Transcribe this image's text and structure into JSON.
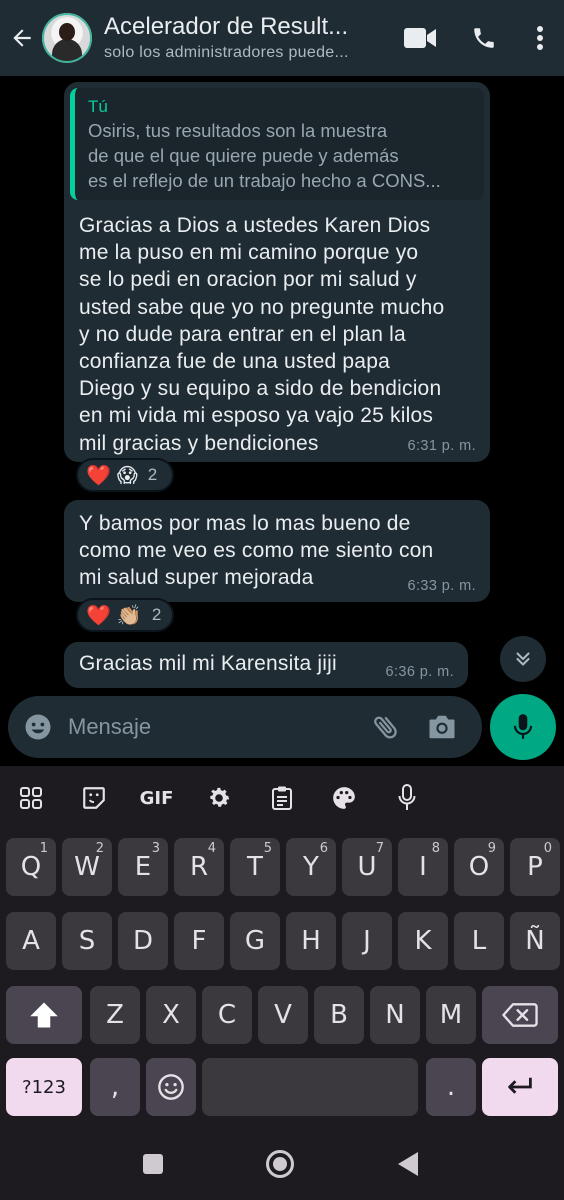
{
  "header": {
    "title": "Acelerador de Result...",
    "subtitle": "solo los administradores puede...",
    "icons": [
      "back-arrow-icon",
      "video-call-icon",
      "phone-icon",
      "more-vert-icon"
    ]
  },
  "messages": [
    {
      "quote": {
        "author": "Tú",
        "text": "Osiris, tus resultados son la muestra\nde que el que quiere puede y además\nes el reflejo de un trabajo hecho a CONS..."
      },
      "text": "Gracias a Dios a ustedes  Karen Dios\nme la puso en mi camino porque yo\nse lo pedi en oracion por mi salud y\nusted sabe que yo no pregunte mucho\ny no dude para entrar en el plan la\nconfianza fue de una usted papa\nDiego y su equipo a sido de bendicion\nen mi vida mi esposo ya vajo 25 kilos\nmil gracias y bendiciones",
      "time": "6:31 p. m.",
      "reactions": {
        "emojis": [
          "❤️",
          "😱"
        ],
        "count": "2"
      }
    },
    {
      "text": "Y bamos por mas lo mas bueno de\ncomo me veo es como me siento con\nmi salud super mejorada",
      "time": "6:33 p. m.",
      "reactions": {
        "emojis": [
          "❤️",
          "👏🏼"
        ],
        "count": "2"
      }
    },
    {
      "text": "Gracias mil mi Karensita jiji",
      "time": "6:36 p. m."
    }
  ],
  "composer": {
    "placeholder": "Mensaje",
    "icons": [
      "emoji-icon",
      "attach-icon",
      "camera-icon",
      "mic-icon"
    ]
  },
  "keyboard": {
    "toolbar": [
      "apps-icon",
      "sticker-icon",
      "GIF",
      "settings-icon",
      "clipboard-icon",
      "palette-icon",
      "mic-icon"
    ],
    "row1": [
      {
        "k": "Q",
        "h": "1"
      },
      {
        "k": "W",
        "h": "2"
      },
      {
        "k": "E",
        "h": "3"
      },
      {
        "k": "R",
        "h": "4"
      },
      {
        "k": "T",
        "h": "5"
      },
      {
        "k": "Y",
        "h": "6"
      },
      {
        "k": "U",
        "h": "7"
      },
      {
        "k": "I",
        "h": "8"
      },
      {
        "k": "O",
        "h": "9"
      },
      {
        "k": "P",
        "h": "0"
      }
    ],
    "row2": [
      "A",
      "S",
      "D",
      "F",
      "G",
      "H",
      "J",
      "K",
      "L",
      "Ñ"
    ],
    "row3": [
      "Z",
      "X",
      "C",
      "V",
      "B",
      "N",
      "M"
    ],
    "row4": {
      "symbols": "?123",
      "comma": ",",
      "period": "."
    }
  },
  "colors": {
    "header_bg": "#1f2c34",
    "bubble_bg": "#202c33",
    "quote_accent": "#06cf9c",
    "mic_button": "#00a884",
    "keyboard_bg": "#1d1a20",
    "accent_key": "#f1d9ee"
  }
}
